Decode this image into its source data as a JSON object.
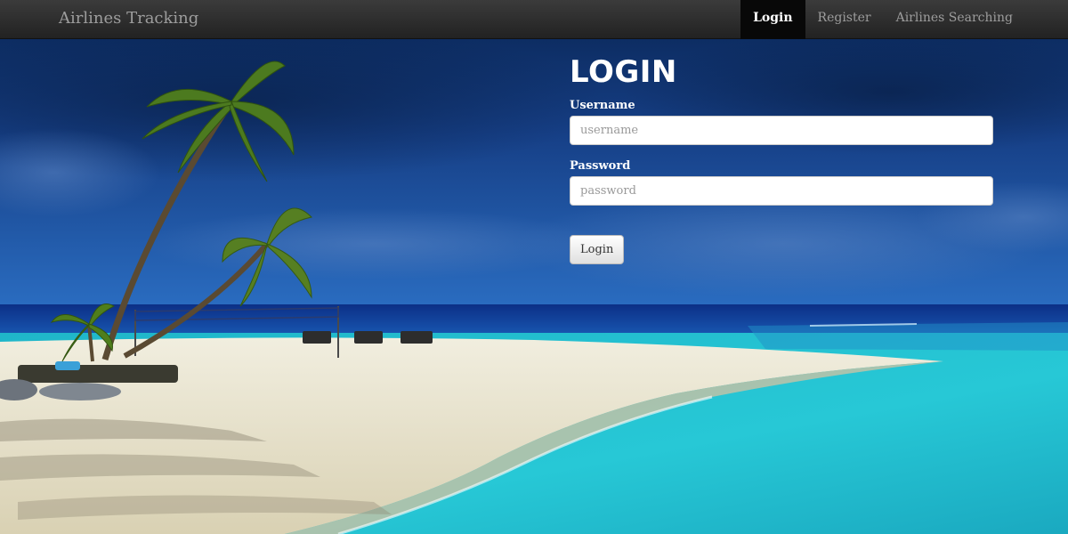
{
  "navbar": {
    "brand": "Airlines Tracking",
    "links": [
      {
        "label": "Login",
        "active": true
      },
      {
        "label": "Register",
        "active": false
      },
      {
        "label": "Airlines Searching",
        "active": false
      }
    ]
  },
  "login": {
    "title": "LOGIN",
    "username_label": "Username",
    "username_placeholder": "username",
    "password_label": "Password",
    "password_placeholder": "password",
    "submit_label": "Login"
  },
  "colors": {
    "navbar": "#2b2b2b",
    "sky": "#1a4f9c",
    "sea": "#22c4d4",
    "sand": "#eae6cf"
  }
}
